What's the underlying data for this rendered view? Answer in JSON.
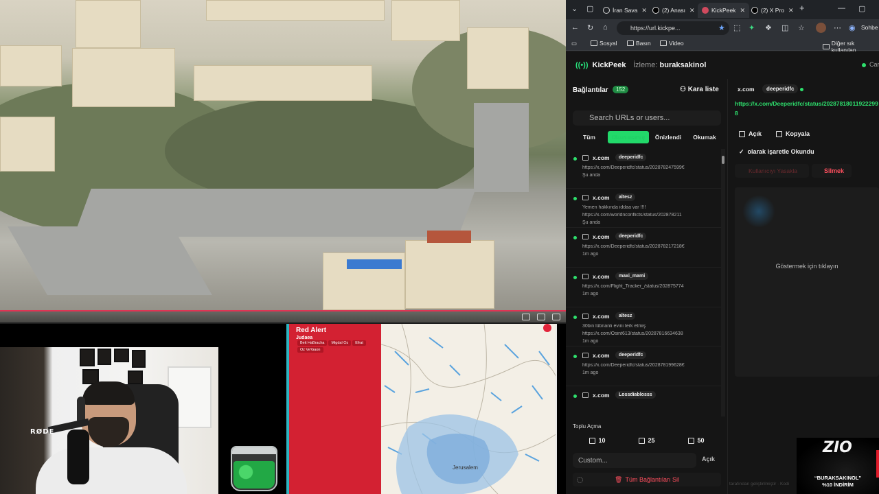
{
  "browser": {
    "tabs": [
      {
        "label": "İran Sava",
        "icon": "globe-icon",
        "active": false
      },
      {
        "label": "(2) Anası",
        "icon": "x-logo-icon",
        "active": false
      },
      {
        "label": "KickPeek",
        "icon": "kickpeek-icon",
        "active": true
      },
      {
        "label": "(2) X Pro",
        "icon": "x-logo-icon",
        "active": false
      }
    ],
    "url": "https://url.kickpe...",
    "bookmarks": [
      "Sosyal",
      "Basın",
      "Video"
    ],
    "other_bookmarks": "Diğer sık kullanılan",
    "edge_right_label": "Sohbe"
  },
  "extension": {
    "brand": "KickPeek",
    "watching_label": "İzleme:",
    "watching_user": "buraksakinol",
    "connection_label": "Car",
    "links_title": "Bağlantılar",
    "links_count": "152",
    "blacklist_label": "Kara liste",
    "search_placeholder": "Search URLs or users...",
    "filters": [
      "Tüm",
      "Okunmamış",
      "Önizlendi",
      "Okumak"
    ],
    "active_filter": "Okunmamış",
    "items": [
      {
        "site": "x.com",
        "user": "deeperidfc",
        "l1": "https://x.com/Deeperidfc/status/202878247599€",
        "l2": "",
        "time": "Şu anda"
      },
      {
        "site": "x.com",
        "user": "altesz",
        "l1": "Yemen hakkında iddaa var !!!!",
        "l2": "https://x.com/worldnconflicts/status/20287821​1",
        "time": "Şu anda"
      },
      {
        "site": "x.com",
        "user": "deeperidfc",
        "l1": "https://x.com/Deeperidfc/status/202878217218€",
        "l2": "",
        "time": "1m ago"
      },
      {
        "site": "x.com",
        "user": "maxi_mami",
        "l1": "https://x.com/Flight_Tracker_/status/20287577​4",
        "l2": "",
        "time": "1m ago"
      },
      {
        "site": "x.com",
        "user": "altesz",
        "l1": "30bin lübnanlı evini terk etmiş",
        "l2": "https://x.com/Osint613/status/202878166346​38",
        "time": "1m ago"
      },
      {
        "site": "x.com",
        "user": "deeperidfc",
        "l1": "https://x.com/Deeperidfc/status/202878199628€",
        "l2": "",
        "time": "1m ago"
      },
      {
        "site": "x.com",
        "user": "Lossdiablosss",
        "l1": "",
        "l2": "",
        "time": ""
      }
    ],
    "bulk_title": "Toplu Açma",
    "bulk_buttons": [
      "10",
      "25",
      "50"
    ],
    "custom_placeholder": "Custom...",
    "custom_open": "Açık",
    "delete_all": "Tüm Bağlantıları Sil",
    "detail": {
      "site": "x.com",
      "user": "deeperidfc",
      "url": "https://x.com/Deeperidfc/status/202878180119222998",
      "open": "Açık",
      "copy": "Kopyala",
      "mark_read": "olarak işaretle Okundu",
      "ban_user": "Kullanıcıyı Yasakla",
      "delete": "Silmek",
      "preview_msg": "Göstermek için tıklayın"
    },
    "footer_faint": "tarafından geliştirilmiştir · Kodi"
  },
  "alert": {
    "title": "Red Alert",
    "region": "Judaea",
    "towns": [
      "Beit HaBracha",
      "Migdal Oz",
      "Efrat",
      "Oz Ve'Gaon"
    ],
    "map_label": "Jerusalem"
  },
  "webcam": {
    "mic_brand": "RØDE"
  },
  "promo": {
    "logo": "ZIO",
    "line1": "“BURAKSAKINOL”",
    "line2": "%10 İNDİRİM"
  },
  "colors": {
    "accent_green": "#22d96a",
    "alert_red": "#d32132",
    "danger": "#ff4f5e"
  }
}
